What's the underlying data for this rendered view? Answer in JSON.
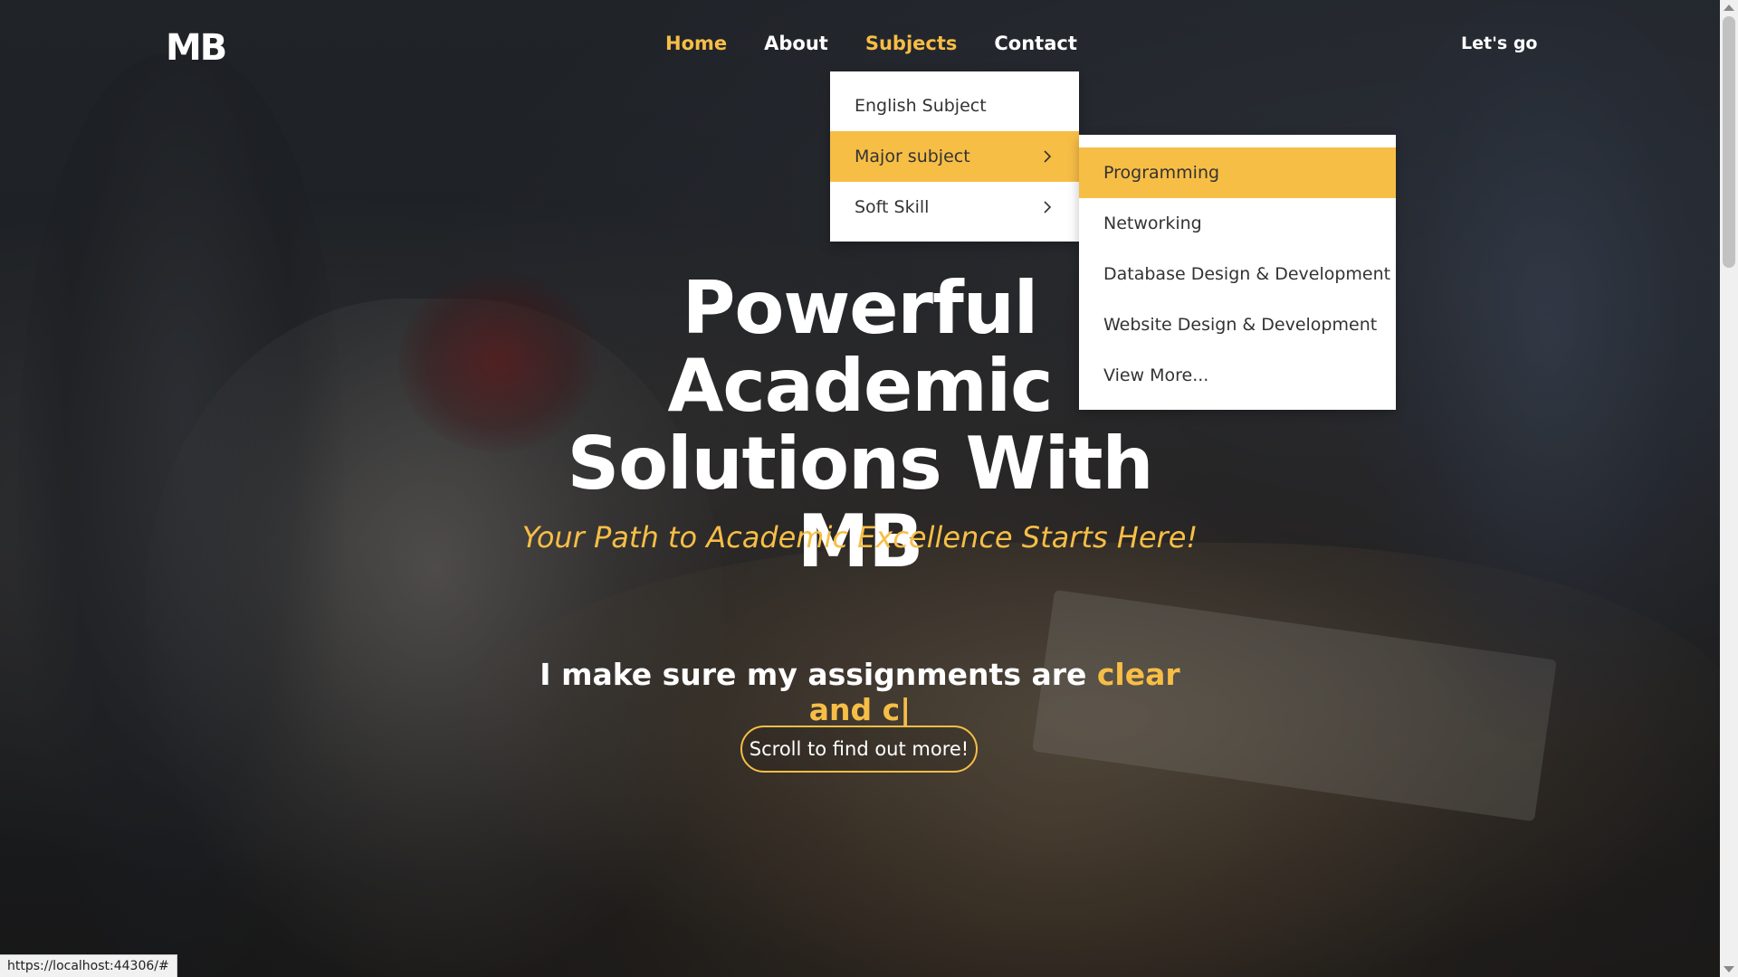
{
  "logo": {
    "text": "MB"
  },
  "nav": {
    "items": [
      {
        "label": "Home",
        "active": true
      },
      {
        "label": "About",
        "active": false
      },
      {
        "label": "Subjects",
        "active": true
      },
      {
        "label": "Contact",
        "active": false
      }
    ],
    "cta_label": "Let's go"
  },
  "subjects_dropdown": {
    "items": [
      {
        "label": "English Subject",
        "has_submenu": false,
        "highlighted": false
      },
      {
        "label": "Major subject",
        "has_submenu": true,
        "highlighted": true
      },
      {
        "label": "Soft Skill",
        "has_submenu": true,
        "highlighted": false
      }
    ]
  },
  "major_submenu": {
    "items": [
      {
        "label": "Programming",
        "highlighted": true
      },
      {
        "label": "Networking",
        "highlighted": false
      },
      {
        "label": "Database Design & Development",
        "highlighted": false
      },
      {
        "label": "Website Design & Development",
        "highlighted": false
      },
      {
        "label": "View More...",
        "highlighted": false
      }
    ]
  },
  "hero": {
    "title_line1": "Powerful",
    "title_line2": "Academic",
    "title_line3": "Solutions With MB",
    "subtitle": "Your Path to Academic Excellence Starts Here!",
    "typing_static": "I make sure my assignments are ",
    "typing_dynamic": "clear and c|",
    "button_label": "Scroll to find out more!"
  },
  "status_bar": {
    "url": "https://localhost:44306/#"
  },
  "colors": {
    "accent": "#f7be46",
    "text": "#ffffff",
    "menu_text": "#333333"
  }
}
